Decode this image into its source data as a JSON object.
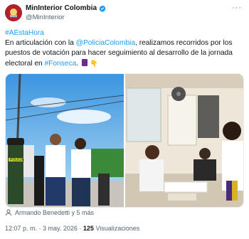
{
  "account": {
    "display_name": "MinInterior Colombia",
    "handle": "@MinInterior",
    "verified_icon": "verified-badge-icon",
    "brand_color": "#b3202a"
  },
  "more_label": "···",
  "tweet": {
    "hashtag_top": "#AEstaHora",
    "line2_pre": "En articulación con la ",
    "mention": "@PoliciaColombia",
    "line2_post": ", realizamos recorridos por los",
    "line3": "puestos de votación para hacer seguimiento al desarrollo de la jornada",
    "line4_pre": "electoral en ",
    "hashtag_place": "#Fonseca",
    "line4_post": ".",
    "emoji_hand": "👇",
    "link_color": "#1d9bf0"
  },
  "media": {
    "photo_left_label": "POLICÍA"
  },
  "tagged": {
    "text": "Armando Benedetti y 5 más"
  },
  "meta": {
    "time": "12:07 p. m.",
    "separator": " · ",
    "date": "3 may. 2026",
    "views_count": "125",
    "views_label": " Visualizaciones"
  }
}
